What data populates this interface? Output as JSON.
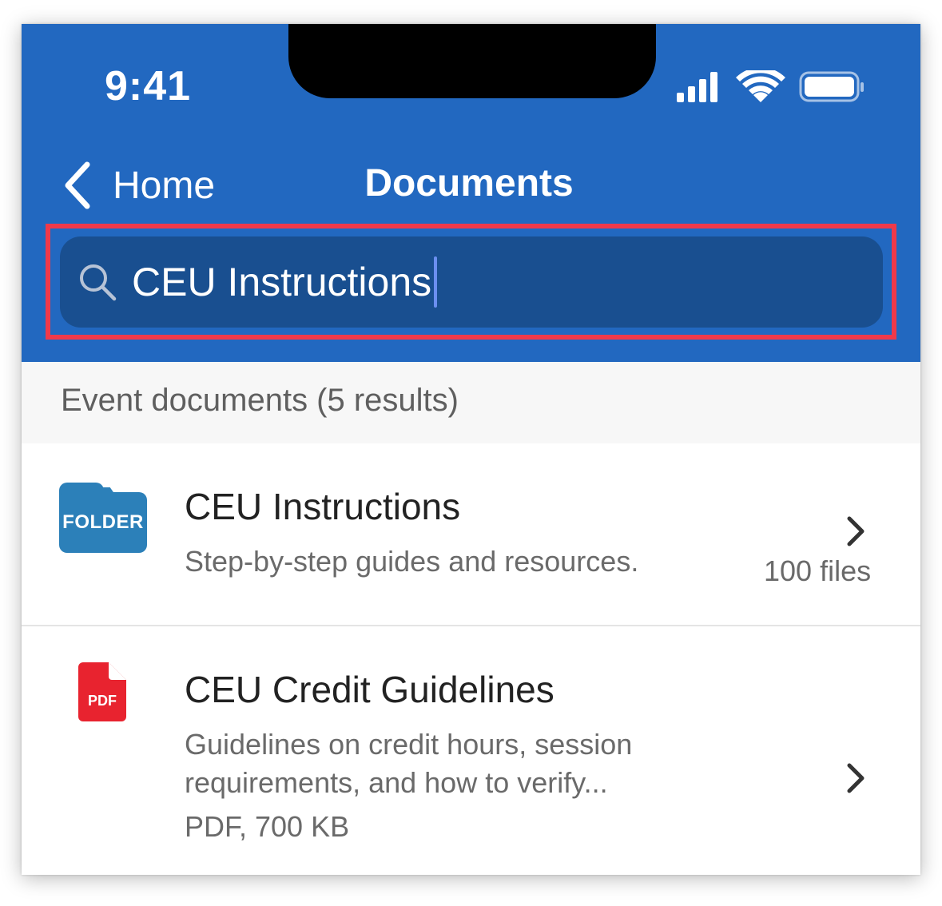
{
  "status_bar": {
    "time": "9:41",
    "icons": [
      "cellular-signal-icon",
      "wifi-icon",
      "battery-icon"
    ]
  },
  "nav": {
    "back_label": "Home",
    "title": "Documents"
  },
  "search": {
    "value": "CEU Instructions",
    "icon": "search-icon"
  },
  "section": {
    "title": "Event documents (5 results)"
  },
  "results": [
    {
      "icon": "folder-icon",
      "icon_label": "FOLDER",
      "title": "CEU Instructions",
      "description": "Step-by-step guides and resources.",
      "meta": "100 files"
    },
    {
      "icon": "pdf-icon",
      "icon_label": "PDF",
      "title": "CEU Credit Guidelines",
      "description_line1": "Guidelines on credit hours, session",
      "description_line2": "requirements, and how to verify...",
      "meta": "PDF, 700 KB"
    }
  ],
  "colors": {
    "header": "#2268c0",
    "search_field": "#194f90",
    "highlight": "#f0394a",
    "folder": "#2c80b9",
    "pdf": "#e8232f"
  }
}
